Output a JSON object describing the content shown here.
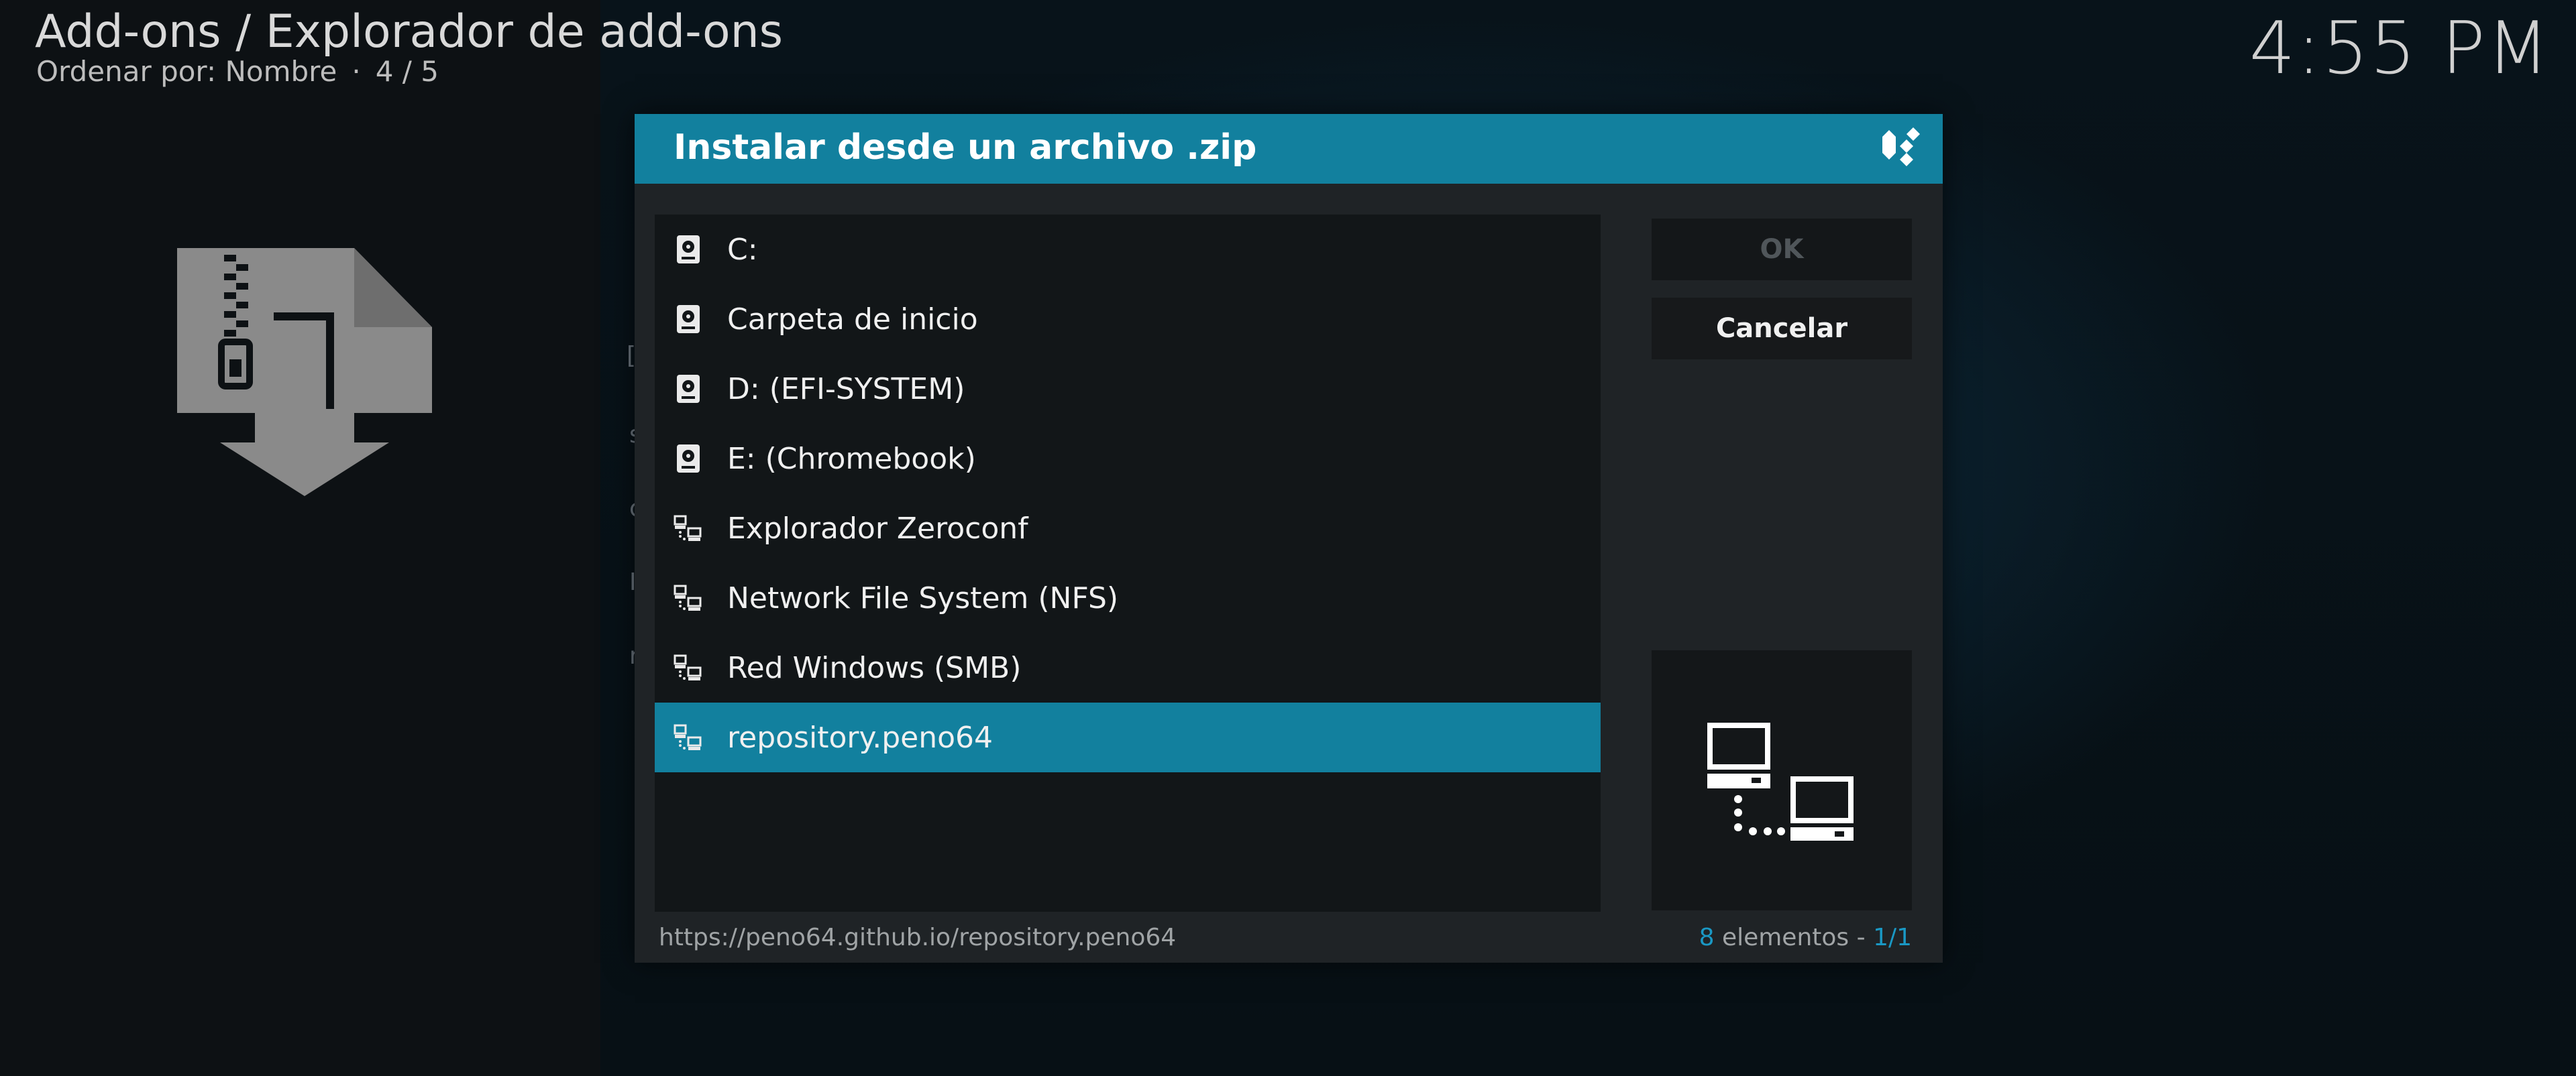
{
  "header": {
    "title": "Add-ons / Explorador de add-ons",
    "sort_label": "Ordenar por: Nombre",
    "separator": "·",
    "position": "4 / 5"
  },
  "clock": "4:55 PM",
  "background_icon": "zip-download-icon",
  "dialog": {
    "title": "Instalar desde un archivo .zip",
    "logo_icon": "kodi-logo-icon",
    "items": [
      {
        "label": "C:",
        "icon": "hard-drive-icon"
      },
      {
        "label": "Carpeta de inicio",
        "icon": "hard-drive-icon"
      },
      {
        "label": "D: (EFI-SYSTEM)",
        "icon": "hard-drive-icon"
      },
      {
        "label": "E: (Chromebook)",
        "icon": "hard-drive-icon"
      },
      {
        "label": "Explorador Zeroconf",
        "icon": "network-icon"
      },
      {
        "label": "Network File System (NFS)",
        "icon": "network-icon"
      },
      {
        "label": "Red Windows (SMB)",
        "icon": "network-icon"
      },
      {
        "label": "repository.peno64",
        "icon": "network-icon",
        "selected": true
      }
    ],
    "buttons": {
      "ok": "OK",
      "cancel": "Cancelar"
    },
    "preview_icon": "network-computers-icon",
    "footer": {
      "path": "https://peno64.github.io/repository.peno64",
      "count": "8",
      "count_label": "elementos -",
      "page": "1/1"
    }
  },
  "colors": {
    "accent": "#12809e",
    "highlight_text": "#1a98c4",
    "dialog_bg": "#1f2326",
    "list_bg": "#121618"
  }
}
